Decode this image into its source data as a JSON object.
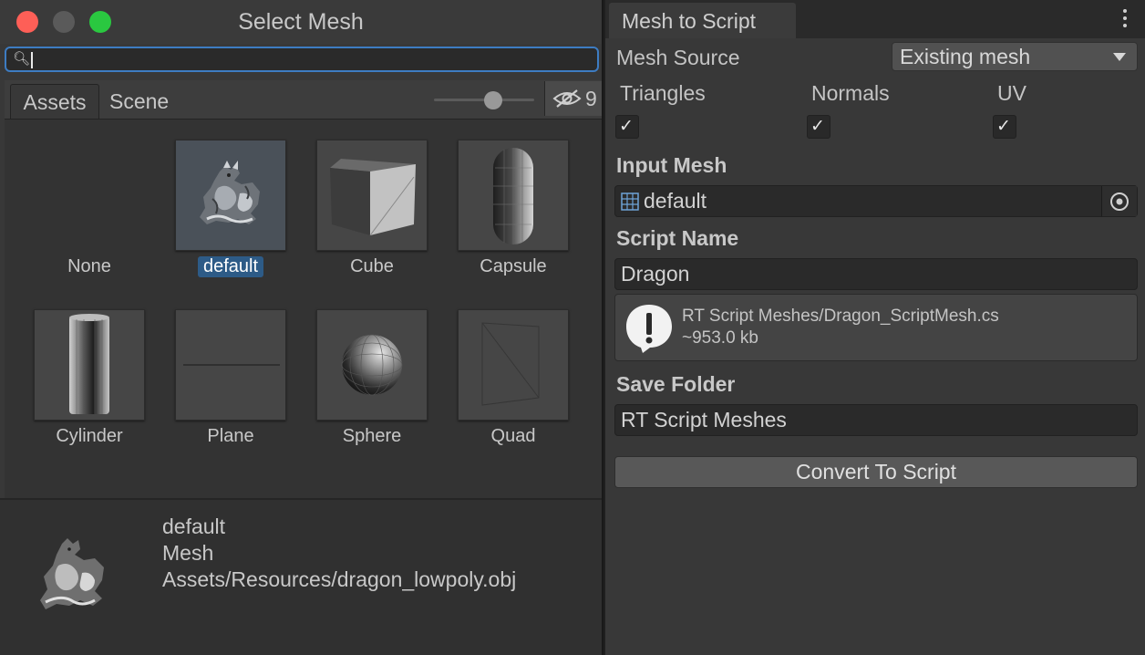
{
  "picker": {
    "title": "Select Mesh",
    "search": {
      "value": ""
    },
    "tabs": {
      "assets": "Assets",
      "scene": "Scene"
    },
    "hidden_count": "9",
    "items": [
      {
        "label": "None",
        "icon": "none",
        "selected": false
      },
      {
        "label": "default",
        "icon": "dragon-mesh-icon",
        "selected": true
      },
      {
        "label": "Cube",
        "icon": "cube-mesh-icon",
        "selected": false
      },
      {
        "label": "Capsule",
        "icon": "capsule-mesh-icon",
        "selected": false
      },
      {
        "label": "Cylinder",
        "icon": "cylinder-mesh-icon",
        "selected": false
      },
      {
        "label": "Plane",
        "icon": "plane-mesh-icon",
        "selected": false
      },
      {
        "label": "Sphere",
        "icon": "sphere-mesh-icon",
        "selected": false
      },
      {
        "label": "Quad",
        "icon": "quad-mesh-icon",
        "selected": false
      }
    ],
    "preview": {
      "name": "default",
      "type": "Mesh",
      "path": "Assets/Resources/dragon_lowpoly.obj"
    }
  },
  "inspector": {
    "tab_title": "Mesh to Script",
    "mesh_source": {
      "label": "Mesh Source",
      "value": "Existing mesh"
    },
    "toggles": [
      {
        "label": "Triangles",
        "checked": true
      },
      {
        "label": "Normals",
        "checked": true
      },
      {
        "label": "UV",
        "checked": true
      }
    ],
    "input_mesh": {
      "label": "Input Mesh",
      "value": "default"
    },
    "script_name": {
      "label": "Script Name",
      "value": "Dragon"
    },
    "info": {
      "line1": "RT Script Meshes/Dragon_ScriptMesh.cs",
      "line2": "~953.0 kb"
    },
    "save_folder": {
      "label": "Save Folder",
      "value": "RT Script Meshes"
    },
    "convert_label": "Convert To Script"
  },
  "colors": {
    "accent": "#3d7cc2",
    "selection": "#2d5b87",
    "close": "#fe5f57",
    "maximize": "#2ac840"
  }
}
